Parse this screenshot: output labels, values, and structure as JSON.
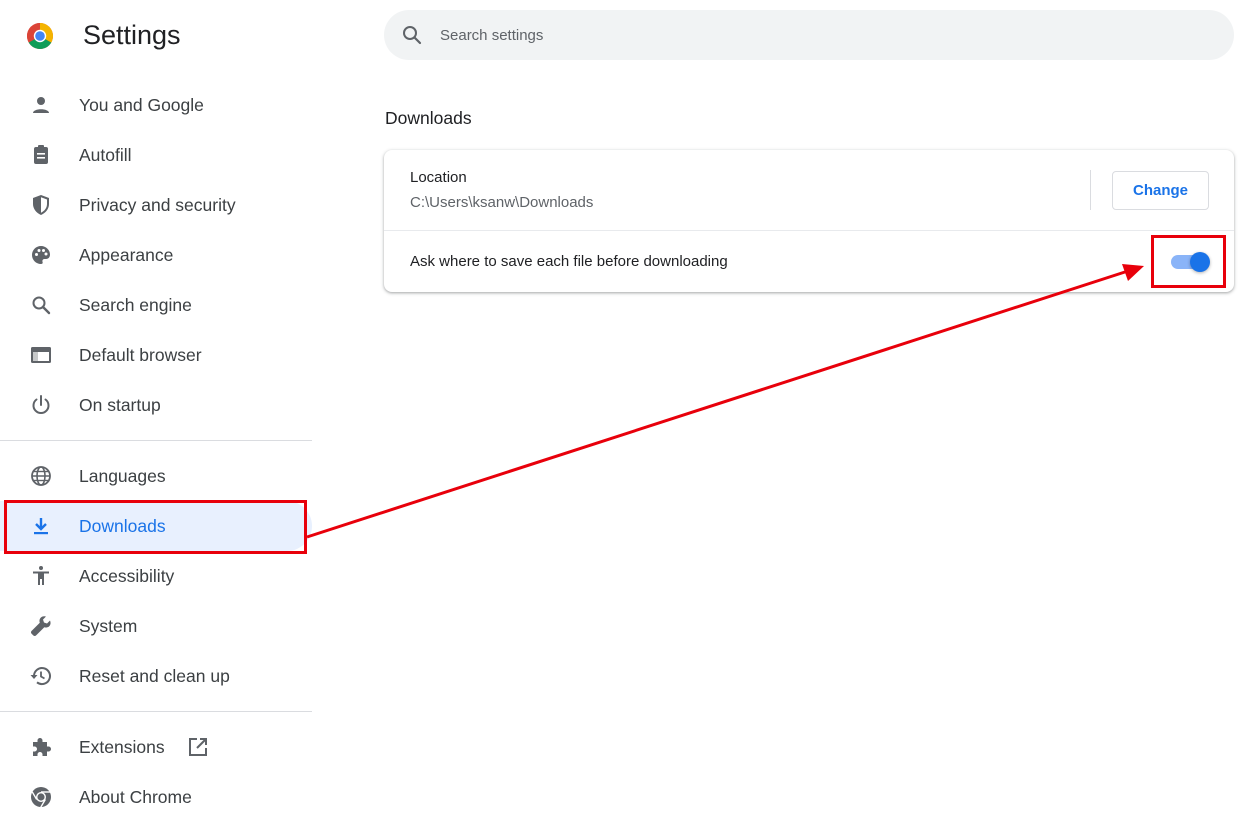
{
  "header": {
    "title": "Settings",
    "search_placeholder": "Search settings",
    "logo_icon": "chrome-logo-icon"
  },
  "sidebar": {
    "items": [
      {
        "label": "You and Google",
        "icon": "person-icon"
      },
      {
        "label": "Autofill",
        "icon": "clipboard-icon"
      },
      {
        "label": "Privacy and security",
        "icon": "shield-icon"
      },
      {
        "label": "Appearance",
        "icon": "palette-icon"
      },
      {
        "label": "Search engine",
        "icon": "search-icon"
      },
      {
        "label": "Default browser",
        "icon": "browser-window-icon"
      },
      {
        "label": "On startup",
        "icon": "power-icon"
      },
      {
        "label": "Languages",
        "icon": "globe-icon"
      },
      {
        "label": "Downloads",
        "icon": "download-icon",
        "active": true
      },
      {
        "label": "Accessibility",
        "icon": "accessibility-icon"
      },
      {
        "label": "System",
        "icon": "wrench-icon"
      },
      {
        "label": "Reset and clean up",
        "icon": "history-icon"
      },
      {
        "label": "Extensions",
        "icon": "puzzle-icon",
        "external_icon": "open-in-new-icon"
      },
      {
        "label": "About Chrome",
        "icon": "chrome-icon"
      }
    ]
  },
  "main": {
    "section_title": "Downloads",
    "location": {
      "label": "Location",
      "path": "C:\\Users\\ksanw\\Downloads",
      "change_label": "Change"
    },
    "ask_before_download": {
      "label": "Ask where to save each file before downloading",
      "enabled": true
    }
  },
  "colors": {
    "accent": "#1a73e8",
    "active_bg": "#e8f0fe",
    "annotation": "#e8000b",
    "toggle_track": "#8ab4f8"
  }
}
